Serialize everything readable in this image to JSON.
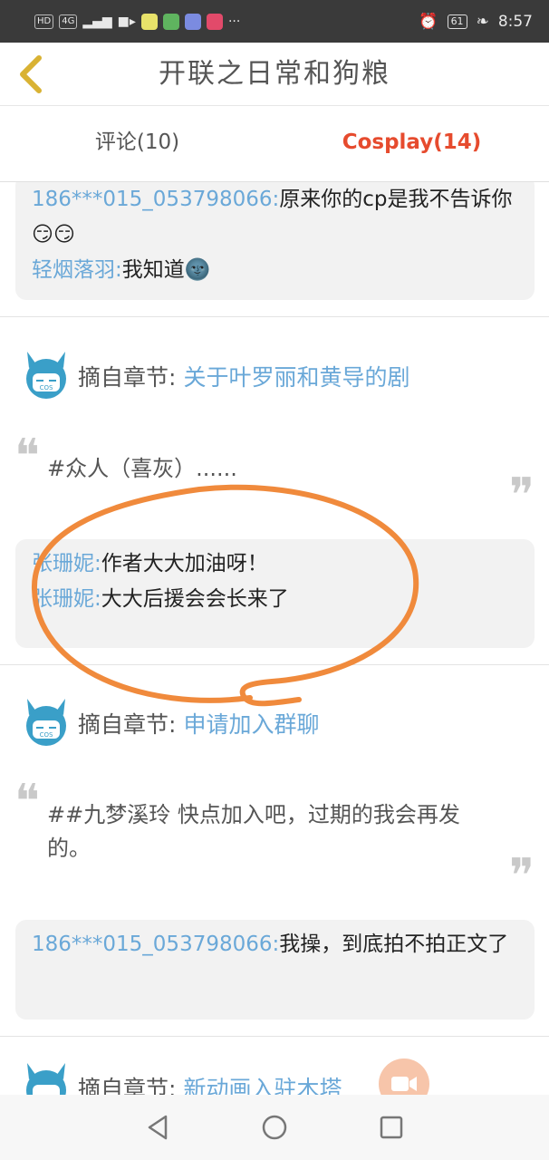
{
  "status_bar": {
    "left_chips": [
      "HD",
      "4G"
    ],
    "more": "···",
    "battery": "61",
    "time": "8:57"
  },
  "header": {
    "title": "开联之日常和狗粮"
  },
  "tabs": [
    {
      "label": "评论(10)",
      "active": false
    },
    {
      "label": "Cosplay(14)",
      "active": true
    }
  ],
  "feed": {
    "top_replies": [
      {
        "user": "186***015_053798066:",
        "text": "原来你的cp是我不告诉你😏😏"
      },
      {
        "user": "轻烟落羽:",
        "text": "我知道🌚"
      }
    ],
    "posts": [
      {
        "chapter_prefix": "摘自章节:",
        "chapter": "关于叶罗丽和黄导的剧",
        "excerpt": "#众人（喜灰）......",
        "replies": [
          {
            "user": "张珊妮:",
            "text": "作者大大加油呀！"
          },
          {
            "user": "张珊妮:",
            "text": "大大后援会会长来了"
          }
        ]
      },
      {
        "chapter_prefix": "摘自章节:",
        "chapter": "申请加入群聊",
        "excerpt": "##九梦溪玲 快点加入吧，过期的我会再发的。",
        "replies": [
          {
            "user": "186***015_053798066:",
            "text": "我操，到底拍不拍正文了"
          }
        ]
      },
      {
        "chapter_prefix": "摘自章节:",
        "chapter": "新动画入驻木塔"
      }
    ]
  },
  "colors": {
    "accent": "#e64b2e",
    "link": "#6aa8d8",
    "annotation": "#f08a3c"
  },
  "icons": {
    "back": "chevron-left-icon",
    "avatar": "cat-avatar-icon",
    "nav": [
      "back-triangle-icon",
      "home-circle-icon",
      "recents-square-icon"
    ],
    "float": "video-camera-icon"
  }
}
